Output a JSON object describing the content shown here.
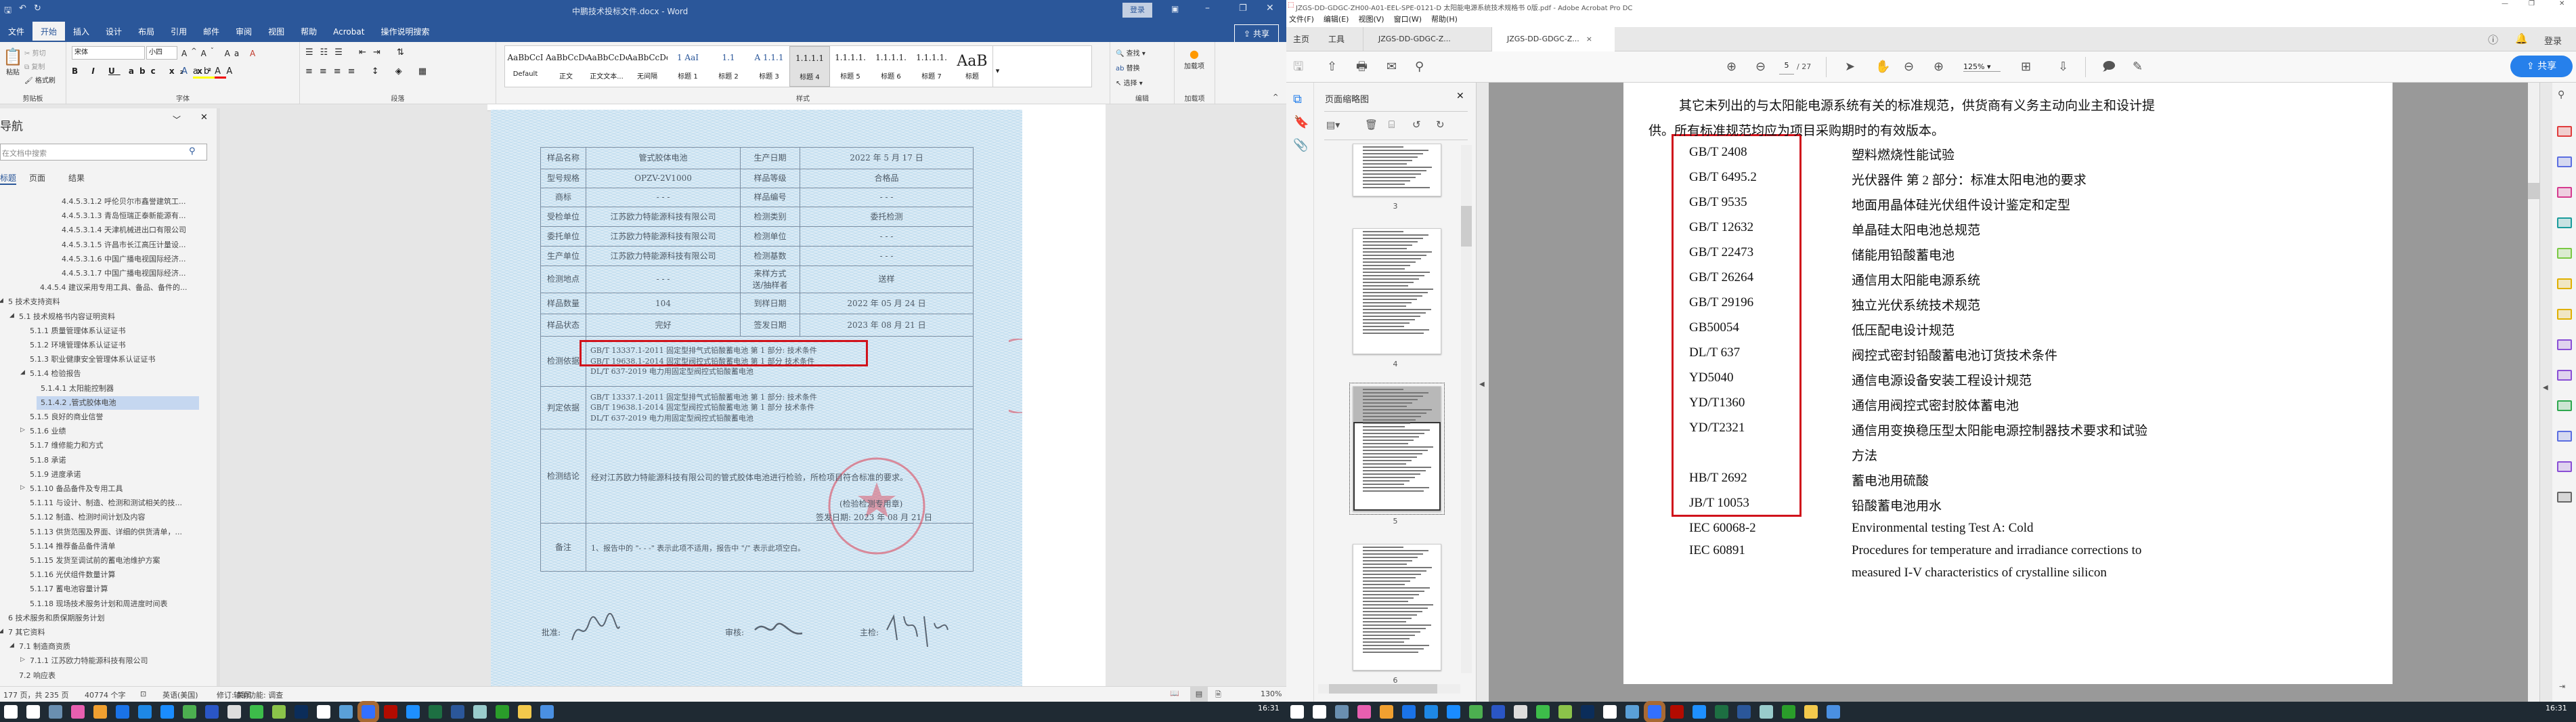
{
  "word": {
    "title": "中鹏技术投标文件.docx  -  Word",
    "login": "登录",
    "share": "共享",
    "tabs": [
      "文件",
      "开始",
      "插入",
      "设计",
      "布局",
      "引用",
      "邮件",
      "审阅",
      "视图",
      "帮助",
      "Acrobat",
      "操作说明搜索"
    ],
    "active_tab": 1,
    "clipboard": {
      "paste": "粘贴",
      "cut": "剪切",
      "copy": "复制",
      "format_painter": "格式刷",
      "label": "剪贴板"
    },
    "font": {
      "name": "宋体",
      "size": "小四",
      "label": "字体"
    },
    "paragraph": {
      "label": "段落"
    },
    "styles": {
      "label": "样式",
      "items": [
        {
          "preview": "AaBbCcI",
          "name": "Default"
        },
        {
          "preview": "AaBbCcDd",
          "name": "正文"
        },
        {
          "preview": "AaBbCcDd",
          "name": "正文文本..."
        },
        {
          "preview": "AaBbCcDd",
          "name": "无间隔"
        },
        {
          "preview": "1  AaI",
          "name": "标题 1"
        },
        {
          "preview": "1.1",
          "name": "标题 2"
        },
        {
          "preview": "A 1.1.1",
          "name": "标题 3"
        },
        {
          "preview": "1.1.1.1",
          "name": "标题 4"
        },
        {
          "preview": "1.1.1.1.",
          "name": "标题 5"
        },
        {
          "preview": "1.1.1.1.",
          "name": "标题 6"
        },
        {
          "preview": "1.1.1.1.",
          "name": "标题 7"
        },
        {
          "preview": "AaB",
          "name": "标题"
        }
      ],
      "selected": 7
    },
    "editing": {
      "find": "查找",
      "replace": "替换",
      "select": "选择",
      "label": "编辑"
    },
    "addins": {
      "button": "加载项",
      "label": "加载项"
    },
    "nav": {
      "title": "导航",
      "search_placeholder": "在文档中搜索",
      "tabs": [
        "标题",
        "页面",
        "结果"
      ],
      "items": [
        {
          "text": "4.4.5.3.1.2 呼伦贝尔市鑫誉建筑工...",
          "level": 5,
          "exp": ""
        },
        {
          "text": "4.4.5.3.1.3 青岛恒瑞正泰新能源有...",
          "level": 5,
          "exp": ""
        },
        {
          "text": "4.4.5.3.1.4 天津机械进出口有限公司",
          "level": 5,
          "exp": ""
        },
        {
          "text": "4.4.5.3.1.5 许昌市长江高压计量设...",
          "level": 5,
          "exp": ""
        },
        {
          "text": "4.4.5.3.1.6 中国广播电视国际经济...",
          "level": 5,
          "exp": ""
        },
        {
          "text": "4.4.5.3.1.7 中国广播电视国际经济...",
          "level": 5,
          "exp": ""
        },
        {
          "text": "4.4.5.4 建议采用专用工具、备品、备件的...",
          "level": 4,
          "exp": ""
        },
        {
          "text": "5 技术支持资料",
          "level": 0,
          "exp": "open"
        },
        {
          "text": "5.1 技术规格书内容证明资料",
          "level": 1,
          "exp": "open"
        },
        {
          "text": "5.1.1 质量管理体系认证证书",
          "level": 2,
          "exp": ""
        },
        {
          "text": "5.1.2 环境管理体系认证证书",
          "level": 2,
          "exp": ""
        },
        {
          "text": "5.1.3 职业健康安全管理体系认证证书",
          "level": 2,
          "exp": ""
        },
        {
          "text": "5.1.4 检验报告",
          "level": 2,
          "exp": "open"
        },
        {
          "text": "5.1.4.1 太阳能控制器",
          "level": 3,
          "exp": ""
        },
        {
          "text": "5.1.4.2 ,管式胶体电池",
          "level": 3,
          "exp": "",
          "selected": true
        },
        {
          "text": "5.1.5 良好的商业信誉",
          "level": 2,
          "exp": ""
        },
        {
          "text": "5.1.6 业绩",
          "level": 2,
          "exp": "closed"
        },
        {
          "text": "5.1.7 维修能力和方式",
          "level": 2,
          "exp": ""
        },
        {
          "text": "5.1.8 承诺",
          "level": 2,
          "exp": ""
        },
        {
          "text": "5.1.9 进度承诺",
          "level": 2,
          "exp": ""
        },
        {
          "text": "5.1.10 备品备件及专用工具",
          "level": 2,
          "exp": "closed"
        },
        {
          "text": "5.1.11 与设计、制造、检测和测试相关的技...",
          "level": 2,
          "exp": ""
        },
        {
          "text": "5.1.12 制造、检测时间计划及内容",
          "level": 2,
          "exp": ""
        },
        {
          "text": "5.1.13 供货范围及界面、详细的供货清单，...",
          "level": 2,
          "exp": ""
        },
        {
          "text": "5.1.14 推荐备品备件清单",
          "level": 2,
          "exp": ""
        },
        {
          "text": "5.1.15 发货至调试前的蓄电池维护方案",
          "level": 2,
          "exp": ""
        },
        {
          "text": "5.1.16 光伏组件数量计算",
          "level": 2,
          "exp": ""
        },
        {
          "text": "5.1.17 蓄电池容量计算",
          "level": 2,
          "exp": ""
        },
        {
          "text": "5.1.18 现场技术服务计划和周进度时间表",
          "level": 2,
          "exp": ""
        },
        {
          "text": "6 技术服务和质保期服务计划",
          "level": 0,
          "exp": ""
        },
        {
          "text": "7 其它资料",
          "level": 0,
          "exp": "open"
        },
        {
          "text": "7.1 制造商资质",
          "level": 1,
          "exp": "open"
        },
        {
          "text": "7.1.1 江苏欧力特能源科技有限公司",
          "level": 2,
          "exp": "closed"
        },
        {
          "text": "7.2 响应表",
          "level": 1,
          "exp": ""
        }
      ]
    },
    "status": {
      "pages": "177 页，共 235 页",
      "words": "40774 个字",
      "language": "英语(美国)",
      "track": "修订: 关闭",
      "accessibility": "辅助功能: 调查",
      "zoom": "130%"
    },
    "report": {
      "rows": [
        [
          "样品名称",
          "管式胶体电池",
          "生产日期",
          "2022 年 5 月 17 日"
        ],
        [
          "型号规格",
          "OPZV-2V1000",
          "样品等级",
          "合格品"
        ],
        [
          "商标",
          "- - -",
          "样品编号",
          "- - -"
        ],
        [
          "受检单位",
          "江苏欧力特能源科技有限公司",
          "检测类别",
          "委托检测"
        ],
        [
          "委托单位",
          "江苏欧力特能源科技有限公司",
          "检测单位",
          "- - -"
        ],
        [
          "生产单位",
          "江苏欧力特能源科技有限公司",
          "检测基数",
          "- - -"
        ],
        [
          "检测地点",
          "- - -",
          "来样方式\n送/抽样者",
          "送样"
        ],
        [
          "样品数量",
          "104",
          "到样日期",
          "2022 年 05 月 24 日"
        ],
        [
          "样品状态",
          "完好",
          "签发日期",
          "2023 年 08 月 21 日"
        ]
      ],
      "basis_label": "检测依据",
      "basis": [
        "GB/T 13337.1-2011 固定型排气式铅酸蓄电池 第 1 部分: 技术条件",
        "GB/T 19638.1-2014  固定型阀控式铅酸蓄电池 第 1 部分 技术条件",
        "DL/T 637-2019 电力用固定型阀控式铅酸蓄电池"
      ],
      "judge_label": "判定依据",
      "judge": [
        "GB/T 13337.1-2011 固定型排气式铅酸蓄电池 第 1 部分: 技术条件",
        "GB/T 19638.1-2014  固定型阀控式铅酸蓄电池 第 1 部分 技术条件",
        "DL/T 637-2019 电力用固定型阀控式铅酸蓄电池"
      ],
      "conclusion_label": "检测结论",
      "conclusion": "经对江苏欧力特能源科技有限公司的管式胶体电池进行检验，所检项目符合标准的要求。",
      "seal_note": "(检验检测专用章)",
      "issue_date": "签发日期: 2023 年 08 月 21 日",
      "remark_label": "备注",
      "remark": "1、报告中的 \"- - -\" 表示此项不适用，报告中 \"/\" 表示此项空白。",
      "approve": "批准:",
      "review": "审核:",
      "inspector": "主检:",
      "seal_text": "检验检测专用章 (01)"
    }
  },
  "acrobat": {
    "title": "JZGS-DD-GDGC-ZH00-A01-EEL-SPE-0121-D 太阳能电源系统技术规格书 0版.pdf - Adobe Acrobat Pro DC",
    "menu": [
      "文件(F)",
      "编辑(E)",
      "视图(V)",
      "窗口(W)",
      "帮助(H)"
    ],
    "tabs": [
      "主页",
      "工具",
      "JZGS-DD-GDGC-Z...",
      "JZGS-DD-GDGC-Z..."
    ],
    "login": "登录",
    "page_current": "5",
    "page_total": "/ 27",
    "zoom": "125%",
    "share": "共享",
    "thumb_panel_title": "页面缩略图",
    "thumb_labels": [
      "3",
      "4",
      "5",
      "6"
    ],
    "thumb_selected": "5",
    "intro": [
      "其它未列出的与太阳能电源系统有关的标准规范，供货商有义务主动向业主和设计提",
      "供。所有标准规范均应为项目采购期时的有效版本。"
    ],
    "standards": [
      {
        "code": "GB/T 2408",
        "desc": "塑料燃烧性能试验"
      },
      {
        "code": "GB/T 6495.2",
        "desc": "光伏器件  第 2 部分：标准太阳电池的要求"
      },
      {
        "code": "GB/T 9535",
        "desc": "地面用晶体硅光伏组件设计鉴定和定型"
      },
      {
        "code": "GB/T 12632",
        "desc": "单晶硅太阳电池总规范"
      },
      {
        "code": "GB/T 22473",
        "desc": "储能用铅酸蓄电池"
      },
      {
        "code": "GB/T 26264",
        "desc": "通信用太阳能电源系统"
      },
      {
        "code": "GB/T 29196",
        "desc": "独立光伏系统技术规范"
      },
      {
        "code": "GB50054",
        "desc": "低压配电设计规范"
      },
      {
        "code": "DL/T 637",
        "desc": "阀控式密封铅酸蓄电池订货技术条件"
      },
      {
        "code": "YD5040",
        "desc": "通信电源设备安装工程设计规范"
      },
      {
        "code": "YD/T1360",
        "desc": "通信用阀控式密封胶体蓄电池"
      },
      {
        "code": "YD/T2321",
        "desc": "通信用变换稳压型太阳能电源控制器技术要求和试验",
        "desc2": "方法"
      },
      {
        "code": "HB/T 2692",
        "desc": "蓄电池用硫酸"
      },
      {
        "code": "JB/T 10053",
        "desc": "铅酸蓄电池用水"
      },
      {
        "code": "IEC 60068-2",
        "desc": "Environmental testing Test A: Cold"
      },
      {
        "code": "IEC 60891",
        "desc": "Procedures  for  temperature  and  irradiance  corrections  to",
        "desc2": "measured   I-V   characteristics   of   crystalline   silicon"
      }
    ],
    "tools_colors": [
      "#e03c3c",
      "#5b6ee1",
      "#d63b8f",
      "#1a9c9c",
      "#7ac943",
      "#e0b000",
      "#e0b000",
      "#8a4fd6",
      "#8a4fd6",
      "#2ea84f",
      "#5b6ee1",
      "#8a4fd6",
      "#666666"
    ]
  },
  "taskbar": {
    "time": "16:31",
    "left_icons": [
      "windows-start",
      "search",
      "calculator",
      "colorwheel",
      "screenshot",
      "dots",
      "tencent-docs",
      "dingtalk",
      "sync",
      "ks-app",
      "usb",
      "wechat",
      "pen-app",
      "photoshop",
      "qq",
      "xin",
      "feishu",
      "acrobat",
      "edge",
      "excel",
      "word",
      "notepad",
      "app-j",
      "file-explorer",
      "pin-app"
    ],
    "right_icons": [
      "windows-start",
      "search",
      "calculator",
      "colorwheel",
      "screenshot",
      "dots",
      "tencent-docs",
      "dingtalk",
      "sync",
      "ks-app",
      "usb",
      "wechat",
      "pen-app",
      "photoshop",
      "qq",
      "xin",
      "feishu",
      "acrobat",
      "edge",
      "excel",
      "word",
      "notepad",
      "app-j",
      "file-explorer",
      "pin-app"
    ],
    "colors": {
      "active": "#a86a34",
      "accent": "#2b579a",
      "red_box": "#d0121b"
    }
  }
}
